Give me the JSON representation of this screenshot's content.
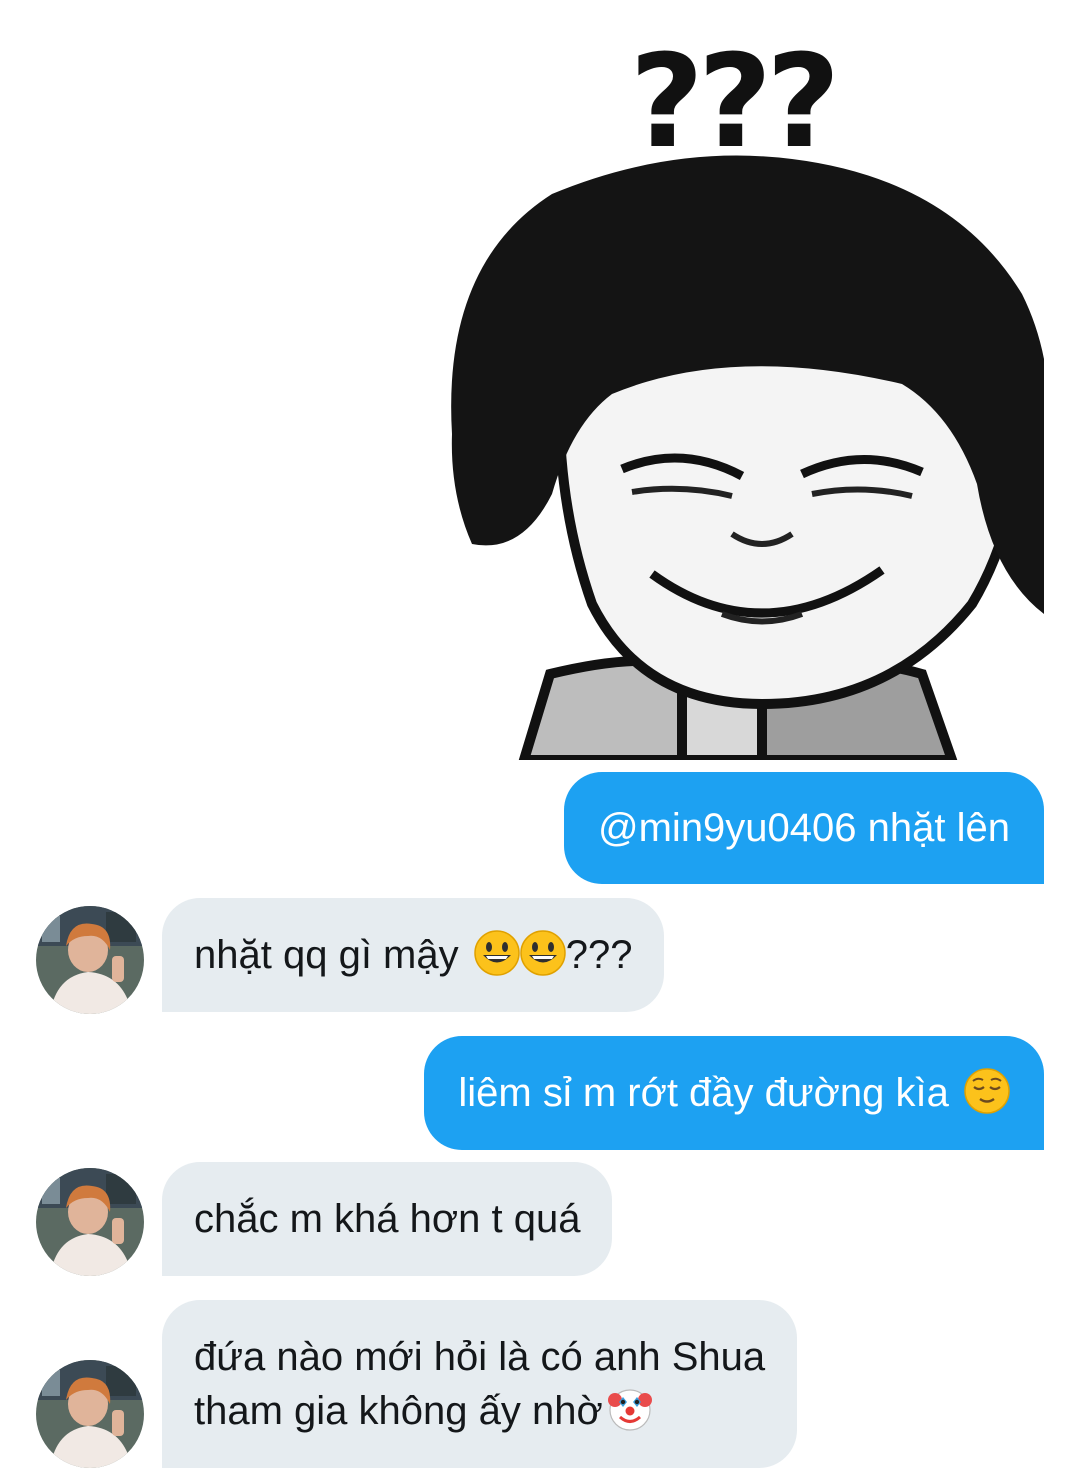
{
  "sticker": {
    "caption": "???",
    "icon": "meme-face-sticker"
  },
  "messages": [
    {
      "direction": "outgoing",
      "text": "@min9yu0406 nhặt lên"
    },
    {
      "direction": "incoming",
      "text": "nhặt qq gì mậy",
      "suffix": "???",
      "emoji": [
        "grinning-face-icon",
        "grinning-face-icon"
      ]
    },
    {
      "direction": "outgoing",
      "text": "liêm sỉ m rớt đầy đường kìa",
      "emoji": [
        "relieved-face-icon"
      ]
    },
    {
      "direction": "incoming",
      "text": "chắc m khá hơn t quá"
    },
    {
      "direction": "incoming",
      "lines": [
        "đứa nào mới hỏi là có anh Shua",
        "tham gia không ấy nhờ"
      ],
      "emoji": [
        "clown-face-icon"
      ]
    }
  ],
  "colors": {
    "outgoing_bubble": "#1da1f2",
    "incoming_bubble": "#e6ecf0",
    "incoming_text": "#14171a",
    "outgoing_text": "#ffffff"
  }
}
